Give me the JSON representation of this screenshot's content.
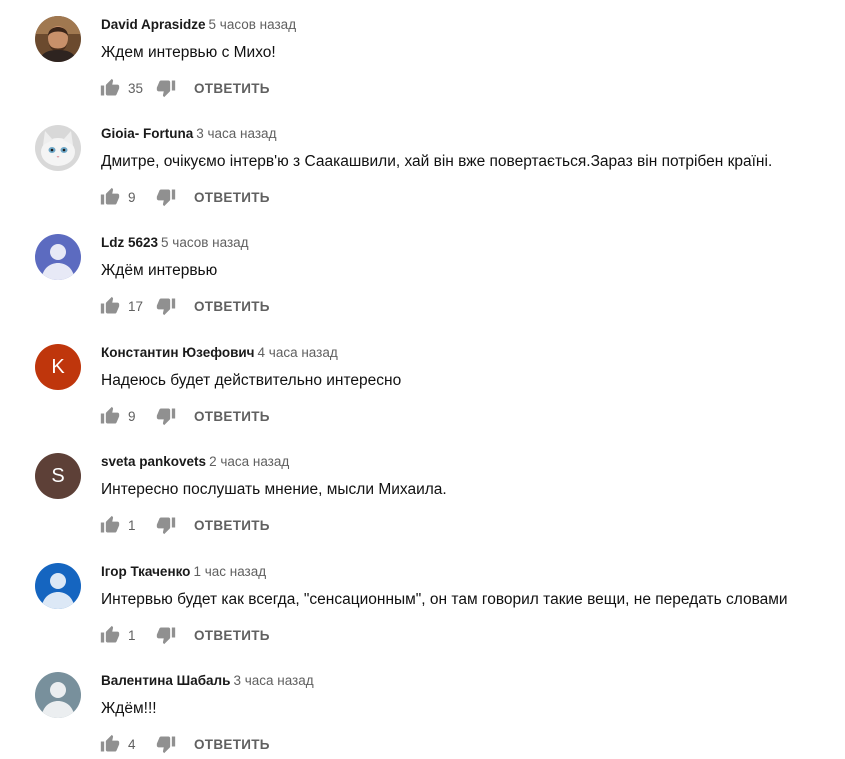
{
  "reply_label": "ОТВЕТИТЬ",
  "comments": [
    {
      "author": "David Aprasidze",
      "time": "5 часов назад",
      "text": "Ждем интервью с Михо!",
      "likes": "35",
      "avatar": {
        "kind": "photo",
        "color": "#8a5a3a"
      }
    },
    {
      "author": "Gioia- Fortuna",
      "time": "3 часа назад",
      "text": "Дмитре, очікуємо інтерв'ю з Саакашвили, хай він вже повертається.Зараз він потрібен країні.",
      "likes": "9",
      "avatar": {
        "kind": "photo-cat",
        "color": "#e6e6e6"
      }
    },
    {
      "author": "Ldz 5623",
      "time": "5 часов назад",
      "text": "Ждём интервью",
      "likes": "17",
      "avatar": {
        "kind": "default",
        "color": "#5c6bc0"
      }
    },
    {
      "author": "Константин Юзефович",
      "time": "4 часа назад",
      "text": "Надеюсь будет действительно интересно",
      "likes": "9",
      "avatar": {
        "kind": "letter",
        "letter": "K",
        "color": "#bf360c"
      }
    },
    {
      "author": "sveta pankovets",
      "time": "2 часа назад",
      "text": "Интересно послушать мнение, мысли Михаила.",
      "likes": "1",
      "avatar": {
        "kind": "letter",
        "letter": "S",
        "color": "#5d4037"
      }
    },
    {
      "author": "Ігор Ткаченко",
      "time": "1 час назад",
      "text": "Интервью будет как всегда, \"сенсационным\", он там говорил такие вещи, не передать словами",
      "likes": "1",
      "avatar": {
        "kind": "default",
        "color": "#1565c0"
      }
    },
    {
      "author": "Валентина Шабаль",
      "time": "3 часа назад",
      "text": "Ждём!!!",
      "likes": "4",
      "avatar": {
        "kind": "default",
        "color": "#78909c"
      }
    }
  ]
}
